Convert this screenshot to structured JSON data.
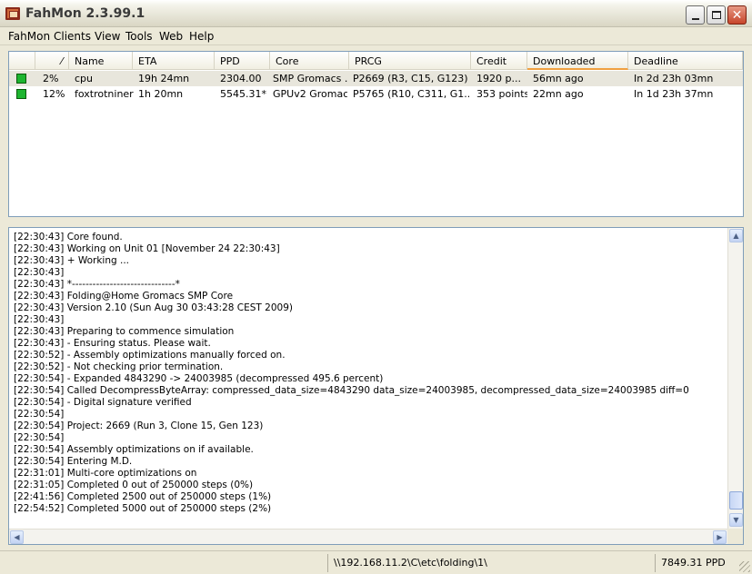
{
  "window": {
    "title": "FahMon 2.3.99.1"
  },
  "menu": [
    "FahMon",
    "Clients",
    "View",
    "Tools",
    "Web",
    "Help"
  ],
  "clients_table": {
    "columns": [
      "",
      "",
      "Name",
      "ETA",
      "PPD",
      "Core",
      "PRCG",
      "Credit",
      "Downloaded",
      "Deadline"
    ],
    "sorted_column": "Downloaded",
    "rows": [
      {
        "status": "running",
        "progress": "2%",
        "name": "cpu",
        "eta": "19h 24mn",
        "ppd": "2304.00",
        "core": "SMP Gromacs ...",
        "prcg": "P2669 (R3, C15, G123)",
        "credit": "1920 p...",
        "downloaded": "56mn ago",
        "deadline": "In 2d 23h 03mn"
      },
      {
        "status": "running",
        "progress": "12%",
        "name": "foxtrotniner",
        "eta": "1h 20mn",
        "ppd": "5545.31*",
        "core": "GPUv2 Gromacs",
        "prcg": "P5765 (R10, C311, G1...",
        "credit": "353 points",
        "downloaded": "22mn ago",
        "deadline": "In 1d 23h 37mn"
      }
    ]
  },
  "log": [
    "[22:30:43] Core found.",
    "[22:30:43] Working on Unit 01 [November 24 22:30:43]",
    "[22:30:43] + Working ...",
    "[22:30:43]",
    "[22:30:43] *------------------------------*",
    "[22:30:43] Folding@Home Gromacs SMP Core",
    "[22:30:43] Version 2.10 (Sun Aug 30 03:43:28 CEST 2009)",
    "[22:30:43]",
    "[22:30:43] Preparing to commence simulation",
    "[22:30:43] - Ensuring status. Please wait.",
    "[22:30:52] - Assembly optimizations manually forced on.",
    "[22:30:52] - Not checking prior termination.",
    "[22:30:54] - Expanded 4843290 -> 24003985 (decompressed 495.6 percent)",
    "[22:30:54] Called DecompressByteArray: compressed_data_size=4843290 data_size=24003985, decompressed_data_size=24003985 diff=0",
    "[22:30:54] - Digital signature verified",
    "[22:30:54]",
    "[22:30:54] Project: 2669 (Run 3, Clone 15, Gen 123)",
    "[22:30:54]",
    "[22:30:54] Assembly optimizations on if available.",
    "[22:30:54] Entering M.D.",
    "[22:31:01] Multi-core optimizations on",
    "[22:31:05] Completed 0 out of 250000 steps  (0%)",
    "[22:41:56] Completed 2500 out of 250000 steps  (1%)",
    "[22:54:52] Completed 5000 out of 250000 steps  (2%)"
  ],
  "statusbar": {
    "path": "\\\\192.168.11.2\\C\\etc\\folding\\1\\",
    "total_ppd": "7849.31 PPD"
  }
}
